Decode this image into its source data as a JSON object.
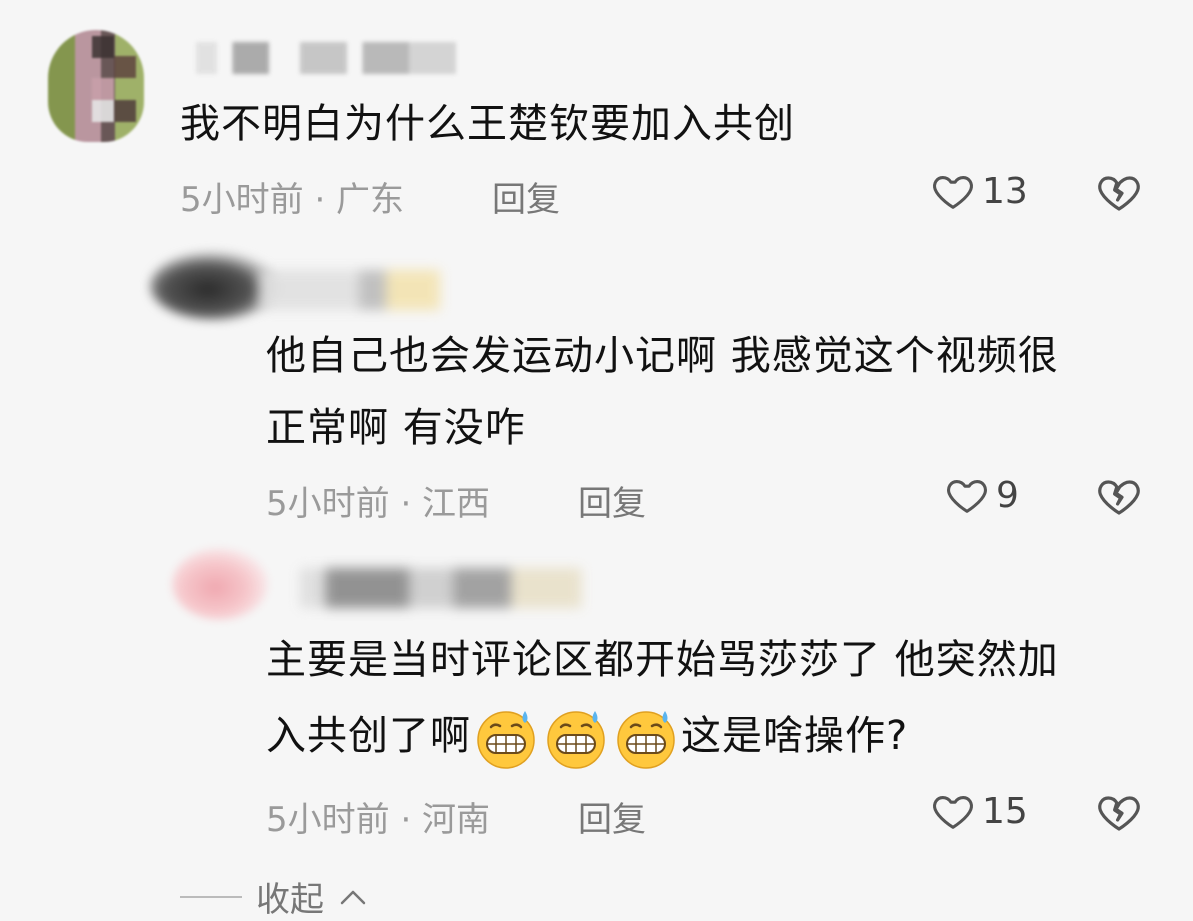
{
  "comments": [
    {
      "text": "我不明白为什么王楚钦要加入共创",
      "time_location": "5小时前 · 广东",
      "reply_label": "回复",
      "likes": "13"
    },
    {
      "text_line1": "他自己也会发运动小记啊 我感觉这个视频很",
      "text_line2": "正常啊 有没咋",
      "time_location": "5小时前 · 江西",
      "reply_label": "回复",
      "likes": "9"
    },
    {
      "text_line1": "主要是当时评论区都开始骂莎莎了 他突然加",
      "text_line2_before": "入共创了啊",
      "text_line2_after": "这是啥操作?",
      "time_location": "5小时前 · 河南",
      "reply_label": "回复",
      "likes": "15"
    }
  ],
  "collapse_label": "收起",
  "icons": {
    "like": "heart-outline-icon",
    "dislike": "broken-heart-icon",
    "emoji": "grinning-sweat-emoji",
    "collapse": "chevron-up-icon"
  },
  "colors": {
    "background": "#f6f6f6",
    "text": "#111111",
    "meta": "#9a9a9a"
  }
}
